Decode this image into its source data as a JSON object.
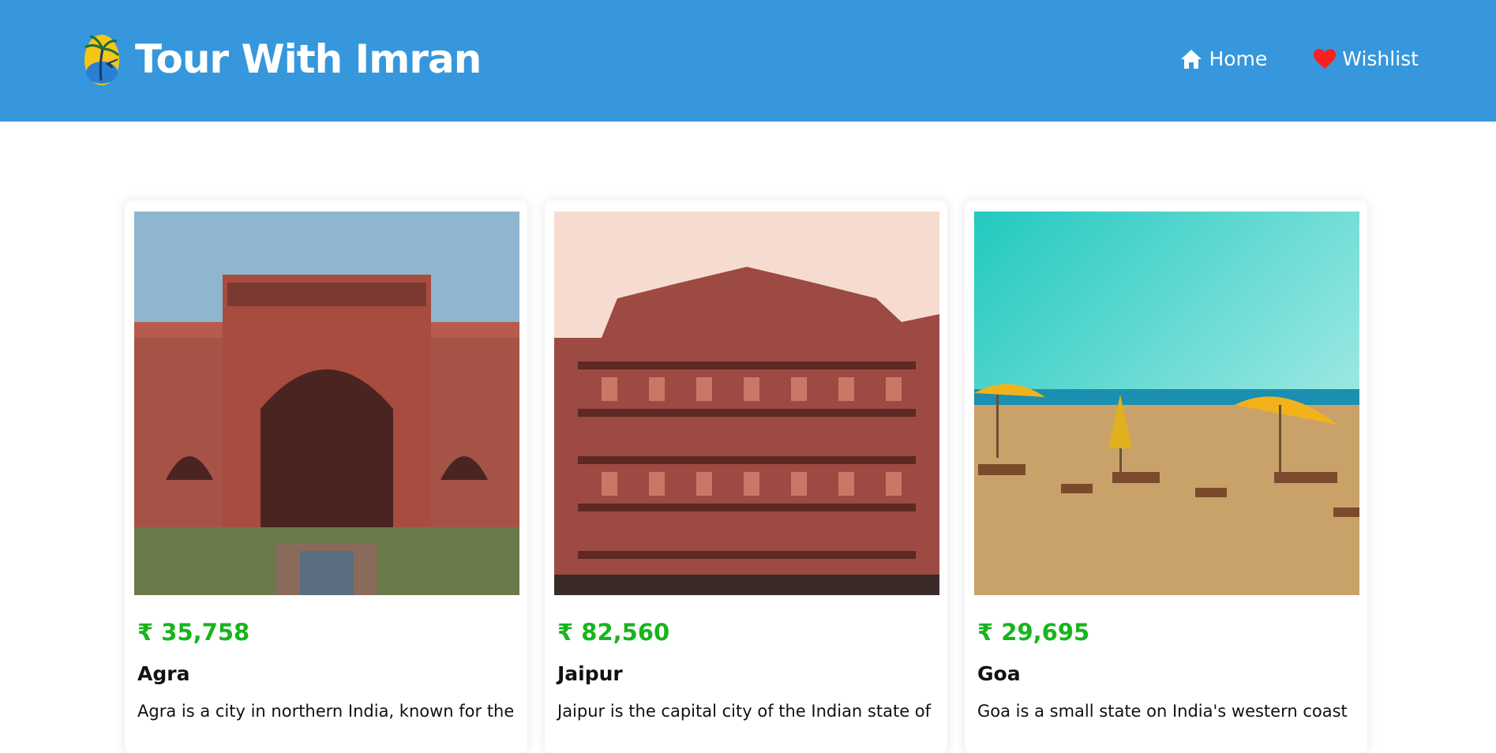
{
  "header": {
    "brand_title": "Tour With Imran",
    "logo_icon": "palm-tree-plane-logo",
    "nav": [
      {
        "label": "Home",
        "icon": "home-icon"
      },
      {
        "label": "Wishlist",
        "icon": "heart-icon"
      }
    ],
    "colors": {
      "background": "#3697dc",
      "heart": "#ff1e1e"
    }
  },
  "tours": [
    {
      "price": "₹ 35,758",
      "name": "Agra",
      "description": "Agra is a city in northern India, known for the",
      "image": "taj-mahal-gate-photo"
    },
    {
      "price": "₹ 82,560",
      "name": "Jaipur",
      "description": "Jaipur is the capital city of the Indian state of",
      "image": "hawa-mahal-photo"
    },
    {
      "price": "₹ 29,695",
      "name": "Goa",
      "description": "Goa is a small state on India's western coast",
      "image": "goa-beach-umbrellas-photo"
    }
  ],
  "colors": {
    "price": "#16b51c"
  }
}
